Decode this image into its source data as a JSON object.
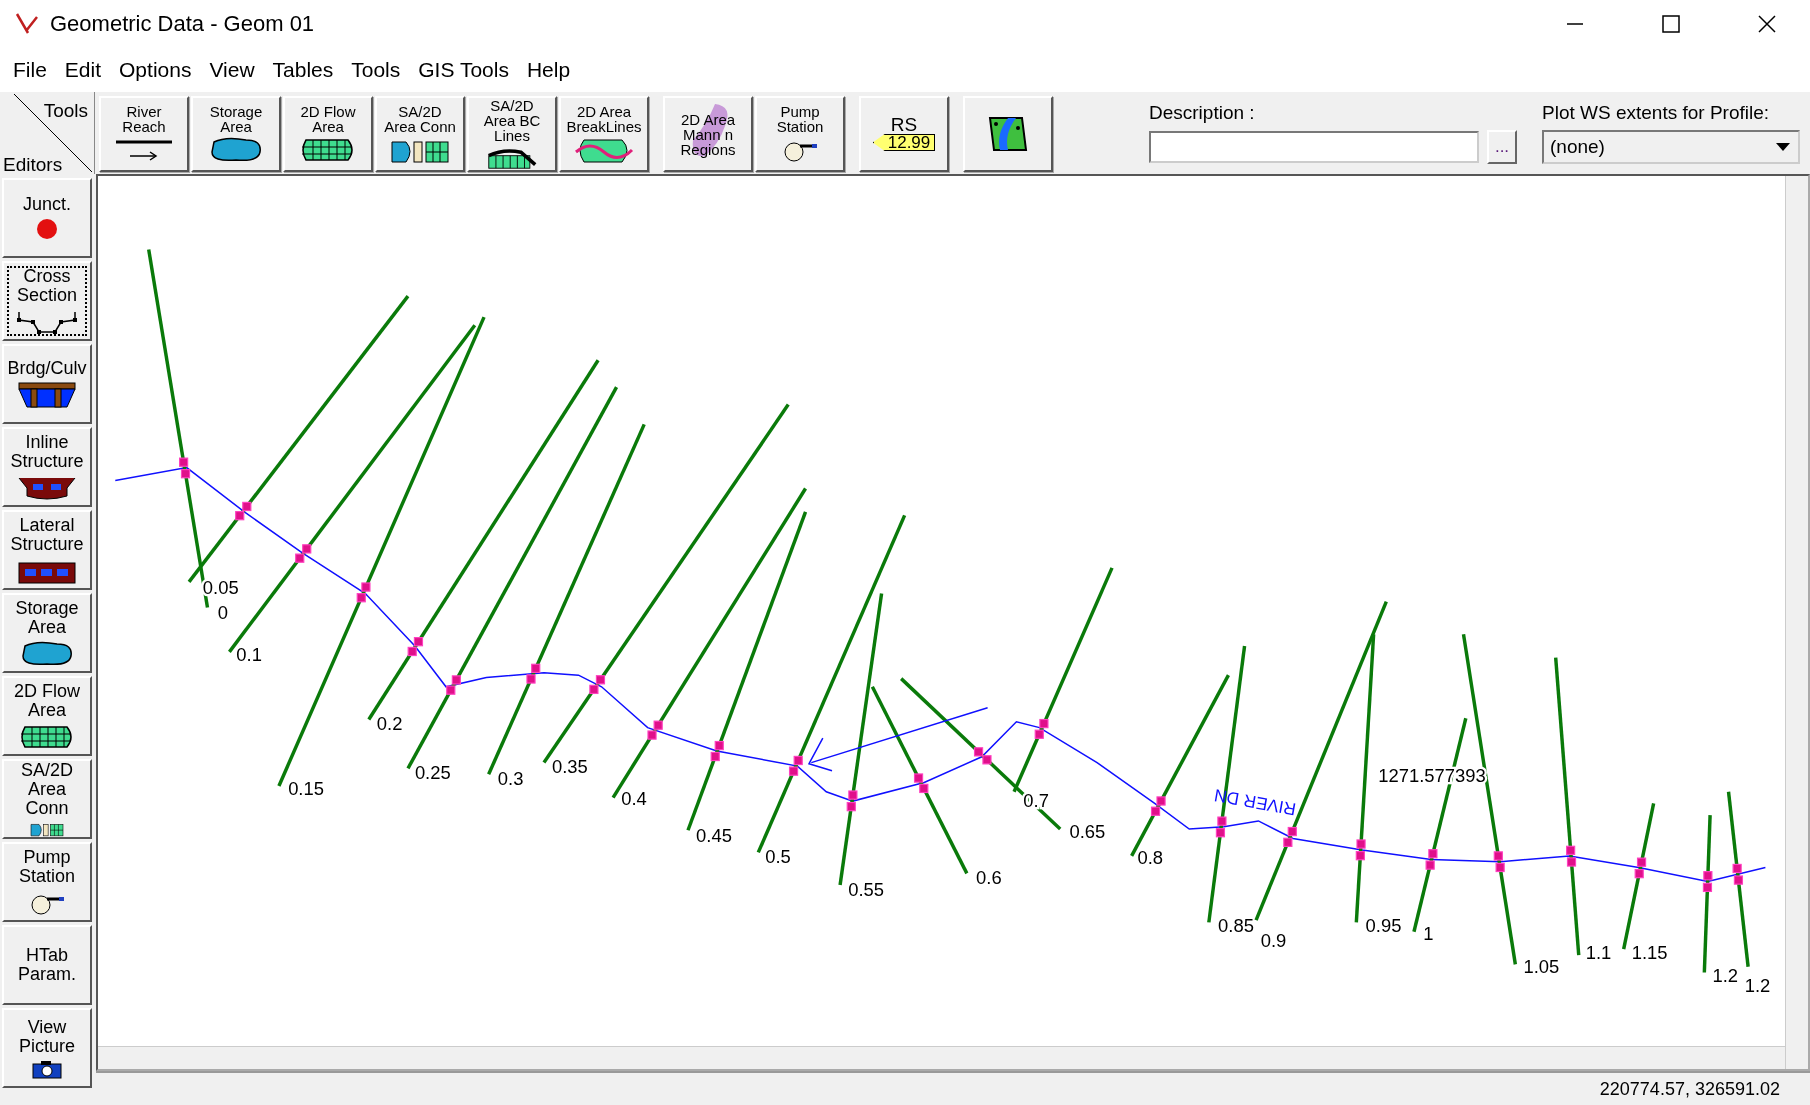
{
  "window": {
    "title": "Geometric Data - Geom 01"
  },
  "menu": [
    "File",
    "Edit",
    "Options",
    "View",
    "Tables",
    "Tools",
    "GIS Tools",
    "Help"
  ],
  "toolbar": {
    "corner_top": "Tools",
    "corner_bottom": "Editors",
    "buttons": [
      {
        "kind": "reach",
        "label": "River Reach"
      },
      {
        "kind": "storage",
        "label": "Storage Area"
      },
      {
        "kind": "flow2d",
        "label": "2D Flow Area"
      },
      {
        "kind": "conn",
        "label": "SA/2D Area Conn"
      },
      {
        "kind": "bclines",
        "label": "SA/2D Area BC Lines"
      },
      {
        "kind": "breaklines",
        "label": "2D Area BreakLines"
      },
      {
        "kind": "mann",
        "label": "2D Area Mann n Regions"
      },
      {
        "kind": "pump",
        "label": "Pump Station"
      },
      {
        "kind": "rs",
        "label": "RS",
        "tag": "12.99"
      },
      {
        "kind": "map"
      }
    ],
    "description": {
      "label": "Description :",
      "browse": "..."
    },
    "profile": {
      "label": "Plot WS extents for Profile:",
      "value": "(none)"
    }
  },
  "editors": [
    {
      "kind": "junction",
      "label": "Junct.",
      "selected": false
    },
    {
      "kind": "xs",
      "label": "Cross Section",
      "selected": true
    },
    {
      "kind": "bridge",
      "label": "Brdg/Culv",
      "selected": false
    },
    {
      "kind": "inline",
      "label": "Inline Structure",
      "selected": false
    },
    {
      "kind": "lateral",
      "label": "Lateral Structure",
      "selected": false
    },
    {
      "kind": "storage",
      "label": "Storage Area",
      "selected": false
    },
    {
      "kind": "flow2d",
      "label": "2D Flow Area",
      "selected": false
    },
    {
      "kind": "conn",
      "label": "SA/2D Area Conn",
      "selected": false
    },
    {
      "kind": "pump",
      "label": "Pump Station",
      "selected": false
    },
    {
      "kind": "htab",
      "label": "HTab Param.",
      "selected": false
    },
    {
      "kind": "picture",
      "label": "View Picture",
      "selected": false
    }
  ],
  "canvas": {
    "reach_label": "RIVER DN",
    "coordinate_label": "1271.577393",
    "cross_sections": [
      "0",
      "0.05",
      "0.1",
      "0.15",
      "0.2",
      "0.25",
      "0.3",
      "0.35",
      "0.4",
      "0.45",
      "0.5",
      "0.55",
      "0.6",
      "0.65",
      "0.7",
      "0.8",
      "0.85",
      "0.9",
      "0.95",
      "1",
      "1.05",
      "1.1",
      "1.15",
      "1.2",
      "1.2"
    ]
  },
  "status_bar": {
    "coordinates": "220774.57, 326591.02"
  }
}
